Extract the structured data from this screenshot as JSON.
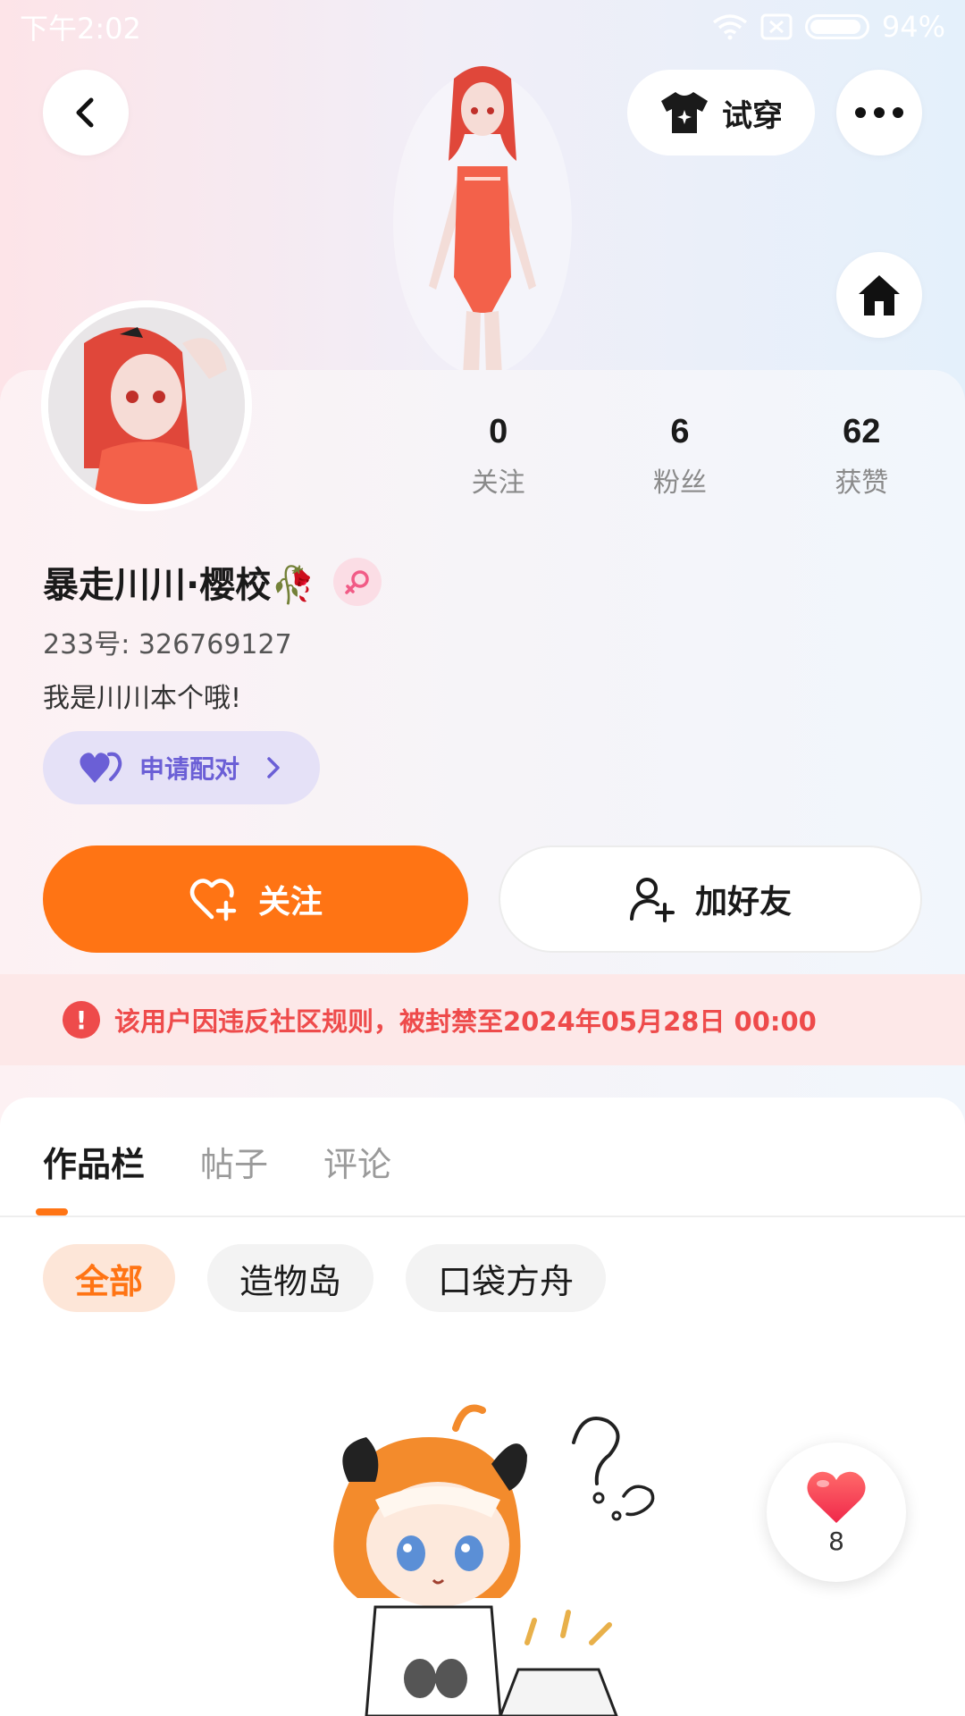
{
  "status_bar": {
    "time": "下午2:02",
    "battery": "94%",
    "battery_level": 0.94
  },
  "header": {
    "back_icon": "chevron-left-icon",
    "try_on_label": "试穿",
    "try_on_icon": "tshirt-icon",
    "more_icon": "more-dots-icon",
    "home_icon": "home-icon"
  },
  "profile": {
    "username": "暴走川川·樱校🥀",
    "gender_icon": "female-symbol-icon",
    "uid": "233号: 326769127",
    "bio": "我是川川本个哦!",
    "pair_button": "申请配对",
    "stats": [
      {
        "value": "0",
        "label": "关注"
      },
      {
        "value": "6",
        "label": "粉丝"
      },
      {
        "value": "62",
        "label": "获赞"
      }
    ]
  },
  "actions": {
    "follow": "关注",
    "add_friend": "加好友"
  },
  "ban_notice": "该用户因违反社区规则，被封禁至2024年05月28日 00:00",
  "tabs": [
    {
      "label": "作品栏",
      "active": true
    },
    {
      "label": "帖子",
      "active": false
    },
    {
      "label": "评论",
      "active": false
    }
  ],
  "chips": [
    {
      "label": "全部",
      "active": true
    },
    {
      "label": "造物岛",
      "active": false
    },
    {
      "label": "口袋方舟",
      "active": false
    }
  ],
  "like_float": {
    "count": "8",
    "icon": "heart-icon"
  },
  "colors": {
    "accent": "#ff7414",
    "ban_red": "#ee4b4b",
    "pair_purple": "#6b5fd6"
  }
}
